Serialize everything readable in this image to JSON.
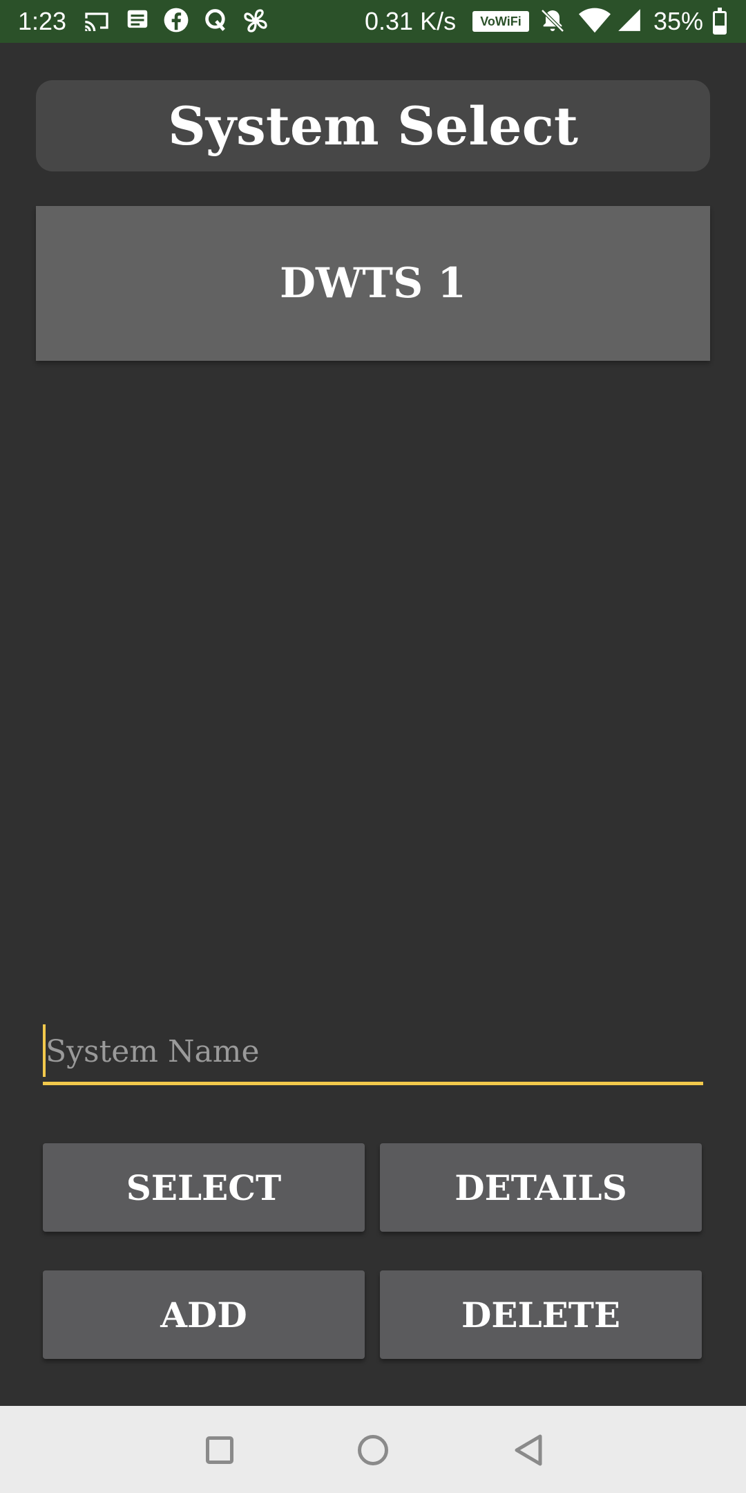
{
  "status_bar": {
    "time": "1:23",
    "speed": "0.31 K/s",
    "vowifi_label": "VoWiFi",
    "battery_percent": "35%",
    "battery_level": 0.35,
    "background_color": "#2b5129",
    "icons": [
      "cast-icon",
      "message-icon",
      "facebook-icon",
      "quora-icon",
      "fan-icon",
      "mute-icon",
      "wifi-icon",
      "signal-icon",
      "battery-icon"
    ]
  },
  "header": {
    "title": "System Select"
  },
  "systems": {
    "items": [
      {
        "label": "DWTS 1"
      }
    ]
  },
  "name_field": {
    "value": "",
    "placeholder": "System Name",
    "accent_color": "#f2c94c"
  },
  "buttons": {
    "select_label": "SELECT",
    "details_label": "DETAILS",
    "add_label": "ADD",
    "delete_label": "DELETE"
  },
  "nav_bar": {
    "icons": [
      "recent-apps-icon",
      "home-icon",
      "back-icon"
    ]
  }
}
